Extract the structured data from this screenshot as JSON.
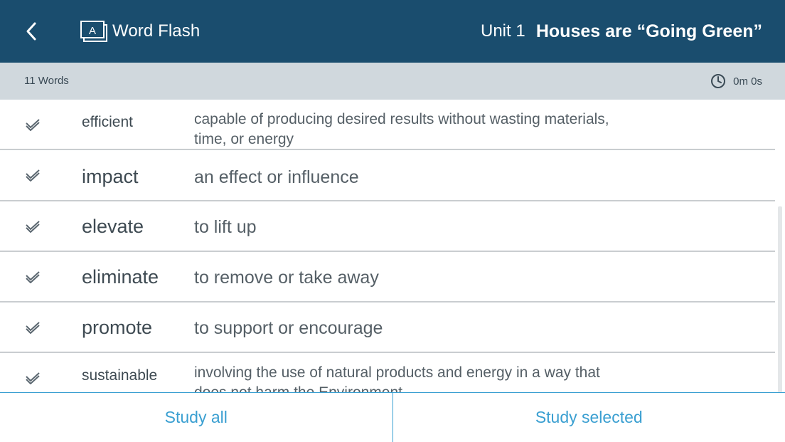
{
  "header": {
    "app_title": "Word Flash",
    "unit_label": "Unit 1",
    "unit_title": "Houses are “Going Green”"
  },
  "subheader": {
    "word_count": "11 Words",
    "timer": "0m 0s"
  },
  "words": [
    {
      "term": "efficient",
      "definition": "capable of producing desired results without wasting materials, time, or energy"
    },
    {
      "term": "impact",
      "definition": "an effect or influence"
    },
    {
      "term": "elevate",
      "definition": "to lift up"
    },
    {
      "term": "eliminate",
      "definition": "to remove or take away"
    },
    {
      "term": "promote",
      "definition": "to support or encourage"
    },
    {
      "term": "sustainable",
      "definition": "involving the use of natural products and energy in a way that does not harm the Environment"
    }
  ],
  "footer": {
    "study_all": "Study all",
    "study_selected": "Study selected"
  },
  "colors": {
    "header_bg": "#1a4d6e",
    "subheader_bg": "#d0d8dd",
    "accent": "#3a9fd1"
  }
}
